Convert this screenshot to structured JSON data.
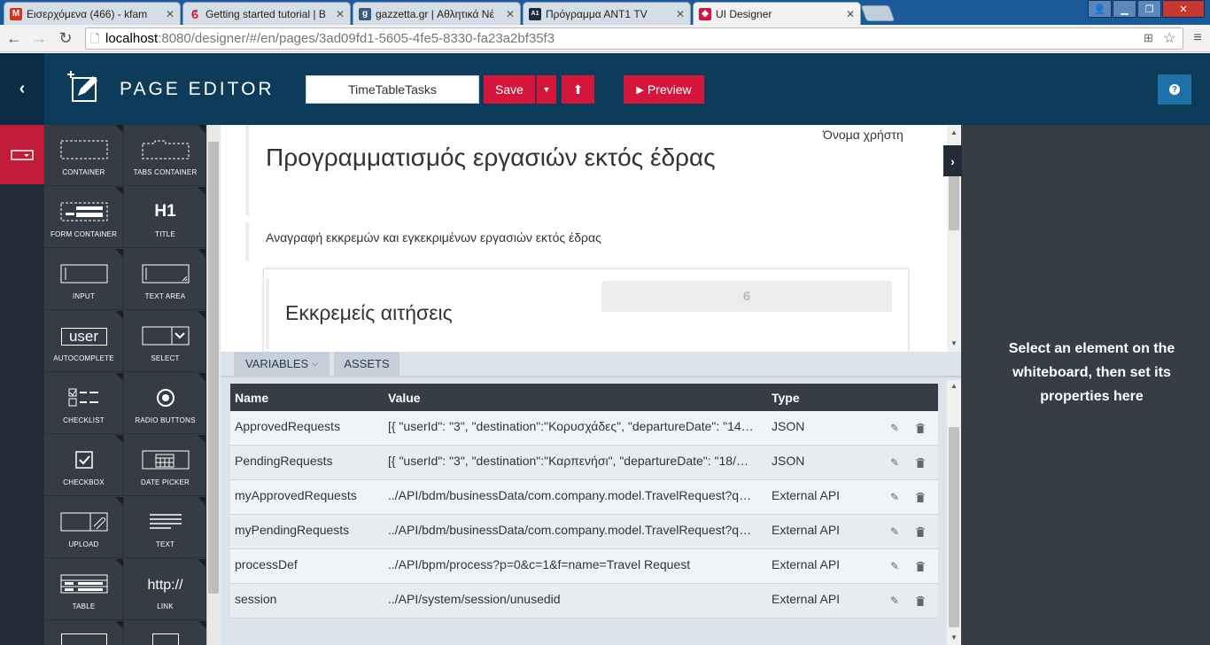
{
  "browser": {
    "tabs": [
      {
        "label": "Εισερχόμενα (466) - kfam",
        "color": "#d9301f",
        "icon": "gmail-icon"
      },
      {
        "label": "Getting started tutorial | B",
        "color": "#d4163c",
        "icon": "bonita-icon"
      },
      {
        "label": "gazzetta.gr | Αθλητικά Νέ",
        "color": "#3a5a80",
        "icon": "gazzetta-icon"
      },
      {
        "label": "Πρόγραμμα ΑΝΤ1 TV",
        "color": "#1a2a40",
        "icon": "ant1-icon"
      },
      {
        "label": "UI Designer",
        "color": "#d4163c",
        "icon": "bonita-icon"
      }
    ],
    "url_host": "localhost",
    "url_path": ":8080/designer/#/en/pages/3ad09fd1-5605-4fe5-8330-fa23a2bf35f3"
  },
  "header": {
    "title": "PAGE EDITOR",
    "page_name": "TimeTableTasks",
    "save_label": "Save",
    "preview_label": "Preview",
    "help_label": "?"
  },
  "palette": [
    {
      "label": "CONTAINER",
      "icon": "container-icon"
    },
    {
      "label": "TABS CONTAINER",
      "icon": "tabs-container-icon"
    },
    {
      "label": "FORM CONTAINER",
      "icon": "form-container-icon"
    },
    {
      "label": "TITLE",
      "icon": "title-icon",
      "glyph": "H1"
    },
    {
      "label": "INPUT",
      "icon": "input-icon"
    },
    {
      "label": "TEXT AREA",
      "icon": "text-area-icon"
    },
    {
      "label": "AUTOCOMPLETE",
      "icon": "autocomplete-icon",
      "glyph": "user"
    },
    {
      "label": "SELECT",
      "icon": "select-icon"
    },
    {
      "label": "CHECKLIST",
      "icon": "checklist-icon"
    },
    {
      "label": "RADIO BUTTONS",
      "icon": "radio-buttons-icon"
    },
    {
      "label": "CHECKBOX",
      "icon": "checkbox-icon"
    },
    {
      "label": "DATE PICKER",
      "icon": "date-picker-icon"
    },
    {
      "label": "UPLOAD",
      "icon": "upload-icon"
    },
    {
      "label": "TEXT",
      "icon": "text-icon"
    },
    {
      "label": "TABLE",
      "icon": "table-icon"
    },
    {
      "label": "LINK",
      "icon": "link-icon",
      "glyph": "http://"
    }
  ],
  "board": {
    "username_label": "Όνομα χρήστη",
    "heading": "Προγραμματισμός εργασιών εκτός έδρας",
    "subtitle": "Αναγραφή εκκρεμών και εγκεκριμένων εργασιών εκτός έδρας",
    "pending_title": "Εκκρεμείς αιτήσεις",
    "pending_count": "6"
  },
  "right_panel": {
    "hint": "Select an element on the whiteboard, then set its properties here"
  },
  "variables": {
    "tab_variables": "VARIABLES",
    "tab_assets": "ASSETS",
    "col_name": "Name",
    "col_value": "Value",
    "col_type": "Type",
    "rows": [
      {
        "name": "ApprovedRequests",
        "value": "[{ \"userId\": \"3\", \"destination\":\"Κορυσχάδες\", \"departureDate\": \"14…",
        "type": "JSON"
      },
      {
        "name": "PendingRequests",
        "value": "[{ \"userId\": \"3\", \"destination\":\"Καρπενήσι\", \"departureDate\": \"18/…",
        "type": "JSON"
      },
      {
        "name": "myApprovedRequests",
        "value": "../API/bdm/businessData/com.company.model.TravelRequest?q…",
        "type": "External API"
      },
      {
        "name": "myPendingRequests",
        "value": "../API/bdm/businessData/com.company.model.TravelRequest?q…",
        "type": "External API"
      },
      {
        "name": "processDef",
        "value": "../API/bpm/process?p=0&c=1&f=name=Travel Request",
        "type": "External API"
      },
      {
        "name": "session",
        "value": "../API/system/session/unusedid",
        "type": "External API"
      }
    ]
  },
  "colors": {
    "header_bg": "#0d3b5a",
    "accent_red": "#d4163c",
    "rail_bg": "#222b36",
    "palette_bg": "#353c46"
  }
}
